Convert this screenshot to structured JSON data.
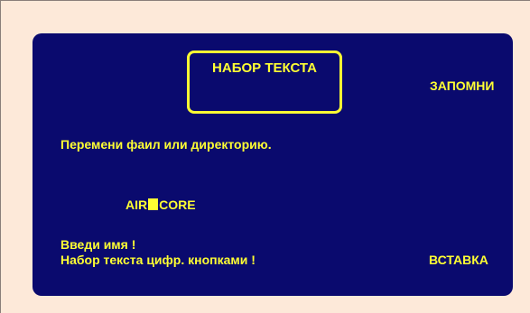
{
  "screen": {
    "title": "НАБОР ТЕКСТА",
    "softkey_top_right": "ЗАПОМНИ",
    "softkey_bottom_right": "ВСТАВКА",
    "instruction": "Перемени фаил или директорию.",
    "input_value_left": "AIR",
    "input_value_right": "CORE",
    "prompt_line1": "Введи имя  !",
    "prompt_line2": "Набор текста цифр. кнопками !"
  },
  "colors": {
    "background": "#fde9d9",
    "screen": "#0a0a6e",
    "text": "#ffff33"
  }
}
